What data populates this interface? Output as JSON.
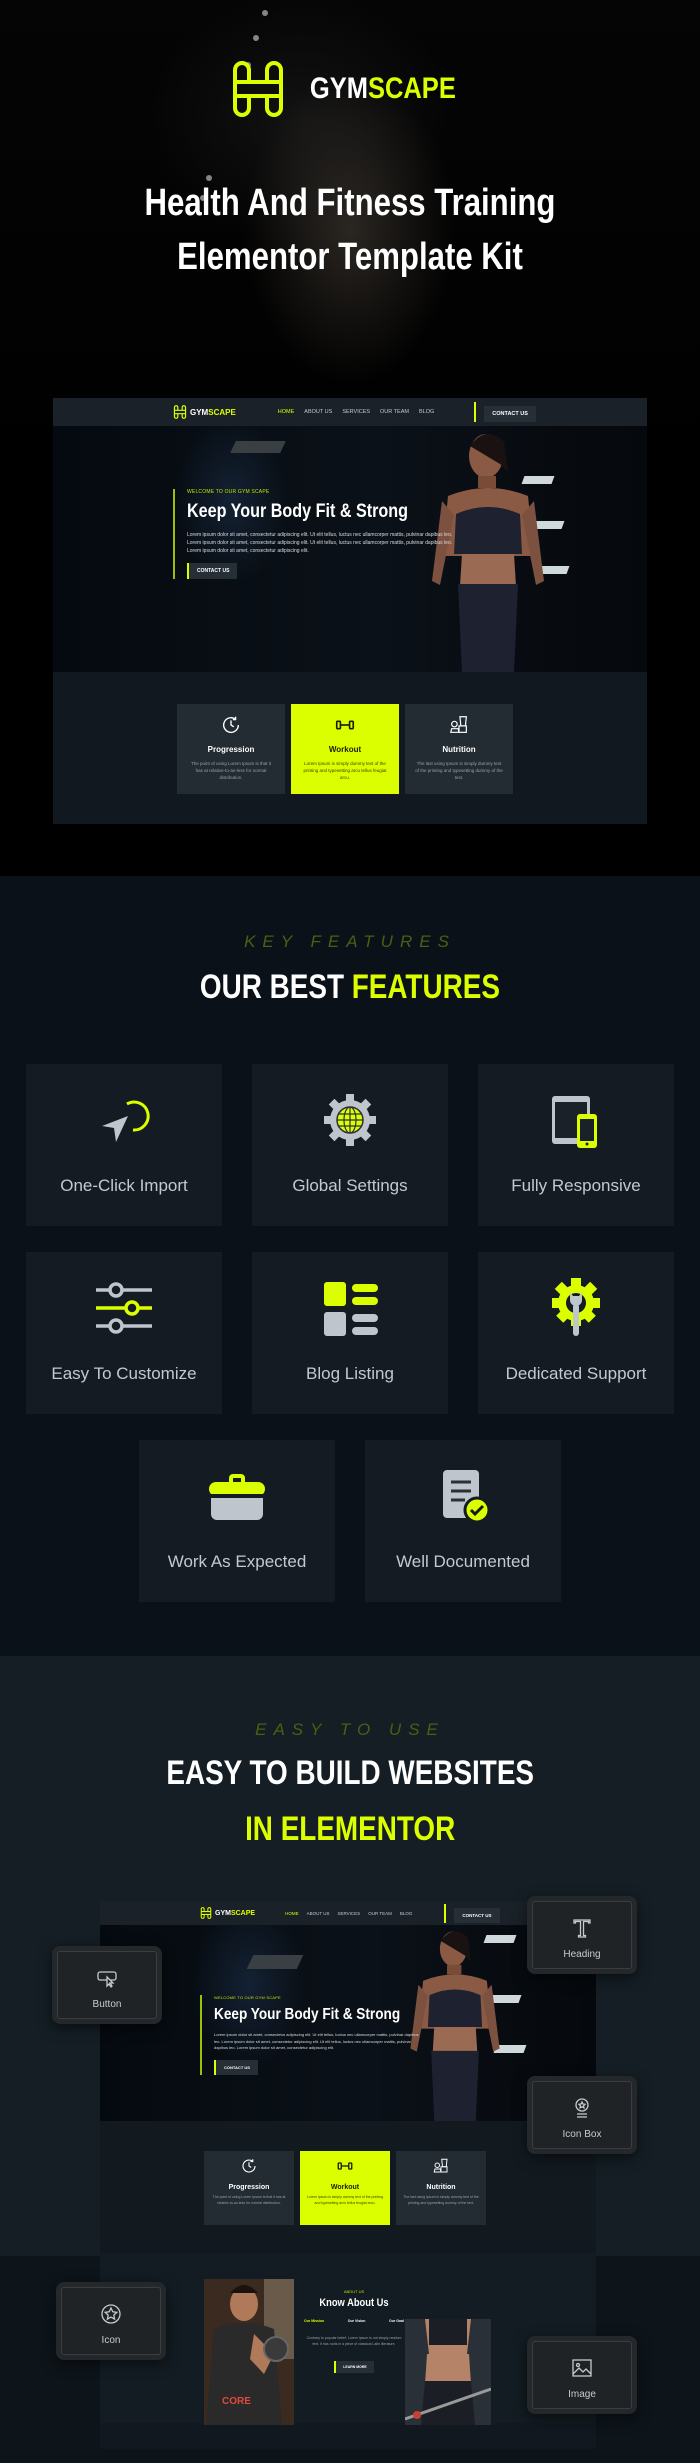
{
  "brand": {
    "name_part1": "GYM",
    "name_part2": "SCAPE",
    "accent": "#dcff00"
  },
  "hero": {
    "title_line1": "Health And Fitness Training",
    "title_line2": "Elementor Template Kit"
  },
  "mock_site": {
    "nav": {
      "items": [
        "HOME",
        "ABOUT US",
        "SERVICES",
        "OUR TEAM",
        "BLOG"
      ],
      "active": "HOME",
      "cta": "CONTACT US"
    },
    "banner": {
      "eyebrow": "WELCOME TO OUR GYM SCAPE",
      "headline": "Keep Your Body Fit & Strong",
      "paragraph": "Lorem ipsum dolor sit amet, consectetur adipiscing elit. Ut elit tellus, luctus nec ullamcorper mattis, pulvinar dapibus leo. Lorem ipsum dolor sit amet, consectetur adipiscing elit. Ut elit tellus, luctus nec ullamcorper mattis, pulvinar dapibus leo. Lorem ipsum dolor sit amet, consectetur adipiscing elit.",
      "button": "CONTACT US"
    },
    "cards": [
      {
        "icon": "clock-refresh-icon",
        "title": "Progression",
        "text": "The point of using Lorem Ipsum is that it has at relative-to-an-less for normal distribution."
      },
      {
        "icon": "dumbbell-icon",
        "title": "Workout",
        "text": "Lorem Ipsum is simply dummy text of the printing and typesetting arcu tellus feugiat arcu."
      },
      {
        "icon": "blender-nutrition-icon",
        "title": "Nutrition",
        "text": "The last using Ipsum is simply dummy text of the printing and typesetting dummy of the text."
      }
    ],
    "about": {
      "eyebrow": "ABOUT US",
      "title": "Know About Us",
      "tabs": [
        "Our Mission",
        "Our Vision",
        "Our Goal"
      ],
      "paragraph": "Contrary to popular belief, Lorem Ipsum is not simply random text. It has roots in a piece of classical Latin literature.",
      "button": "LEARN MORE"
    }
  },
  "features": {
    "eyebrow": "KEY FEATURES",
    "title_white": "OUR BEST",
    "title_accent": "FEATURES",
    "items": [
      {
        "icon": "cursor-click-icon",
        "label": "One-Click Import"
      },
      {
        "icon": "gear-globe-icon",
        "label": "Global Settings"
      },
      {
        "icon": "devices-icon",
        "label": "Fully Responsive"
      },
      {
        "icon": "sliders-icon",
        "label": "Easy To Customize"
      },
      {
        "icon": "list-layout-icon",
        "label": "Blog Listing"
      },
      {
        "icon": "gear-wrench-icon",
        "label": "Dedicated Support"
      },
      {
        "icon": "toolbox-icon",
        "label": "Work As Expected"
      },
      {
        "icon": "document-check-icon",
        "label": "Well Documented"
      }
    ]
  },
  "easy": {
    "eyebrow": "EASY TO USE",
    "title_line1": "EASY TO BUILD WEBSITES",
    "title_line2": "IN ELEMENTOR",
    "widgets": [
      "Button",
      "Heading",
      "Icon Box",
      "Icon",
      "Image"
    ]
  }
}
